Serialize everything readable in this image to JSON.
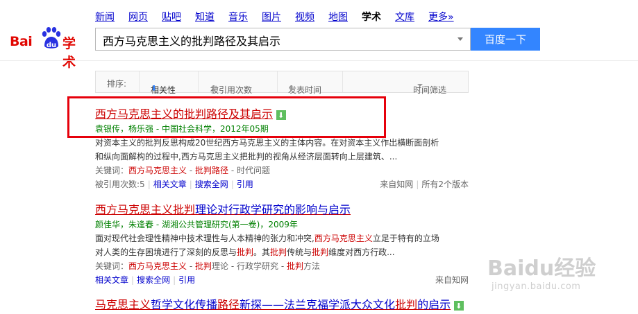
{
  "nav": {
    "items": [
      "新闻",
      "网页",
      "贴吧",
      "知道",
      "音乐",
      "图片",
      "视频",
      "地图",
      "学术",
      "文库",
      "更多»"
    ],
    "active": "学术"
  },
  "logo": {
    "bai": "Bai",
    "du": "du",
    "xueshu": "学术"
  },
  "search": {
    "value": "西方马克思主义的批判路径及其启示",
    "button": "百度一下"
  },
  "sortbar": {
    "label": "排序:",
    "relevance": "相关性",
    "citations": "被引用次数",
    "pubtime": "发表时间",
    "timefilter": "时间筛选"
  },
  "results": [
    {
      "title": "西方马克思主义的批判路径及其启示",
      "meta": "袁银传，杨乐强 - 中国社会科学，2012年05期",
      "abstract_1": "对资本主义的批判反思构成20世纪西方马克思主义的主体内容。在对资本主义作出横断面剖析",
      "abstract_2": "和纵向面解构的过程中,西方马克思主义把批判的视角从经济层面转向上层建筑、...",
      "keywords_label": "关键词：",
      "kw1": "西方马克思主义",
      "kw2": "批判路径",
      "kw3": "时代问题",
      "cited": "被引用次数:5",
      "related": "相关文章",
      "searchall": "搜索全网",
      "cite": "引用",
      "source": "来自知网",
      "versions": "所有2个版本"
    },
    {
      "title_a": "西方马克思主义批判",
      "title_b": "理论对行政学研究的影响与启示",
      "meta": "颜佳华，朱逢春 - 湖湘公共管理研究(第一卷)，2009年",
      "abs1_a": "面对现代社会理性精神中技术理性与人本精神的张力和冲突,",
      "abs1_b": "西方马克思主义",
      "abs1_c": "立足于特有的立场",
      "abs2_a": "对人类的生存困境进行了深刻的反思与",
      "abs2_b": "批判",
      "abs2_c": "。其",
      "abs2_d": "批判",
      "abs2_e": "传统与",
      "abs2_f": "批判",
      "abs2_g": "维度对西方行政...",
      "keywords_label": "关键词：",
      "kw1": "西方马克思主义",
      "kw2a": "批判",
      "kw2b": "理论",
      "kw3": "行政学研究",
      "kw4a": "批判",
      "kw4b": "方法",
      "related": "相关文章",
      "searchall": "搜索全网",
      "cite": "引用",
      "source": "来自知网"
    },
    {
      "t1": "马克思主义",
      "t2": "哲学文化传播",
      "t3": "路径",
      "t4": "新探——法兰克福学派大众文化",
      "t5": "批判",
      "t6": "的启示"
    }
  ],
  "watermark": {
    "text": "Baidu经验",
    "url": "jingyan.baidu.com"
  }
}
